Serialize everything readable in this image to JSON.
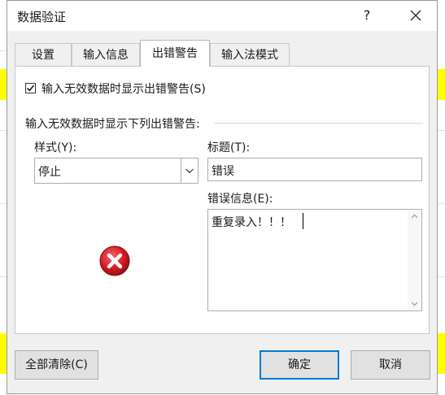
{
  "dialog": {
    "title": "数据验证",
    "help": "?"
  },
  "tabs": [
    {
      "label": "设置"
    },
    {
      "label": "输入信息"
    },
    {
      "label": "出错警告"
    },
    {
      "label": "输入法模式"
    }
  ],
  "error_alert": {
    "show_alert_label": "输入无效数据时显示出错警告(S)",
    "show_alert_checked": true,
    "group_label": "输入无效数据时显示下列出错警告:",
    "style_label": "样式(Y):",
    "style_value": "停止",
    "title_label": "标题(T):",
    "title_value": "错误",
    "message_label": "错误信息(E):",
    "message_value": "重复录入！！！"
  },
  "buttons": {
    "clear_all": "全部清除(C)",
    "ok": "确定",
    "cancel": "取消"
  },
  "colors": {
    "accent": "#0078d7",
    "error_red": "#d7181f",
    "spreadsheet_highlight": "#ffff00"
  },
  "icons": {
    "close": "close-icon",
    "style_icon": "error-stop-icon"
  }
}
